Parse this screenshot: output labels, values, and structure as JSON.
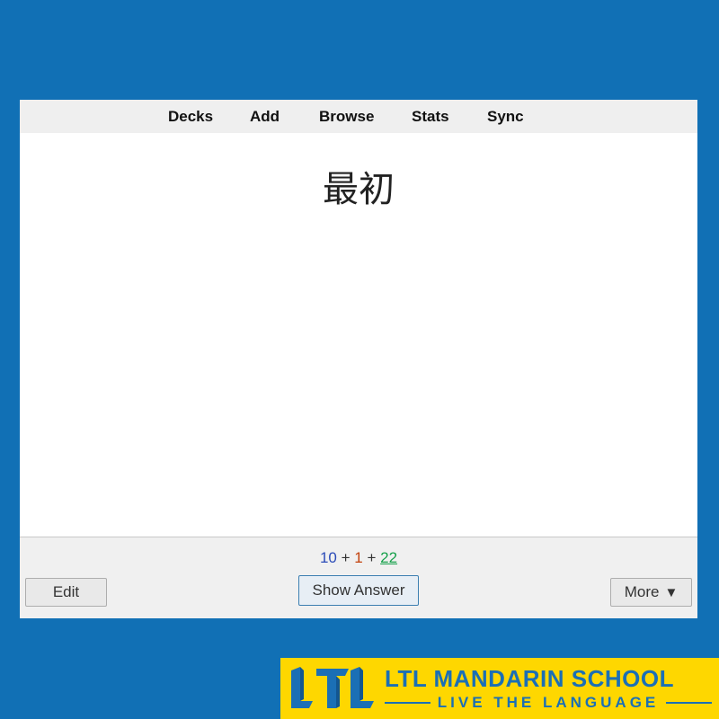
{
  "toolbar": {
    "items": [
      "Decks",
      "Add",
      "Browse",
      "Stats",
      "Sync"
    ]
  },
  "card": {
    "front": "最初"
  },
  "counts": {
    "new": "10",
    "learning": "1",
    "review": "22",
    "separator": "+"
  },
  "buttons": {
    "edit": "Edit",
    "show_answer": "Show Answer",
    "more": "More",
    "more_arrow": "▼"
  },
  "logo": {
    "title": "LTL MANDARIN SCHOOL",
    "tagline": "LIVE THE LANGUAGE",
    "mark": "LTL"
  },
  "colors": {
    "background": "#1170b5",
    "new": "#2b4bb8",
    "learning": "#c2410c",
    "review": "#15a04a",
    "logo_bg": "#fed700",
    "logo_fg": "#1b6fb5"
  }
}
